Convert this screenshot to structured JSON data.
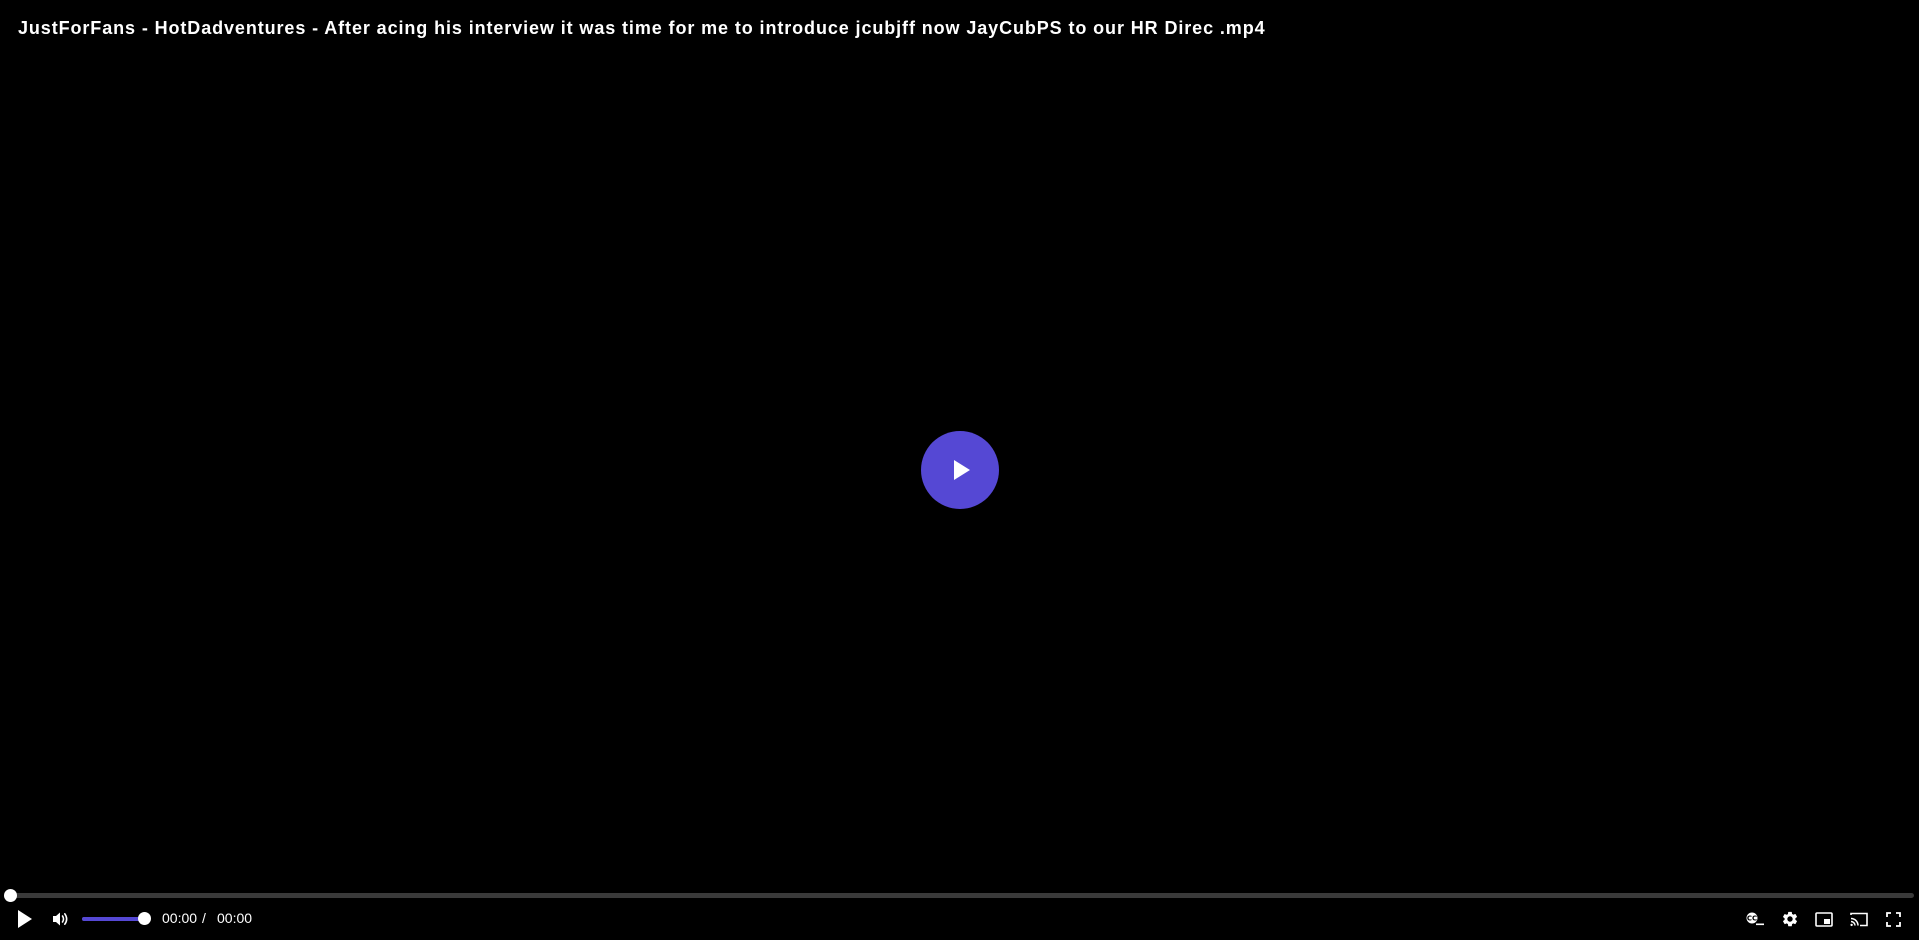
{
  "video": {
    "title": "JustForFans - HotDadventures - After acing his interview it was time for me to introduce jcubjff now JayCubPS to our HR Direc .mp4"
  },
  "playback": {
    "current_time": "00:00",
    "separator": "/",
    "duration": "00:00",
    "progress_fraction": 0,
    "volume_fraction": 1
  },
  "icons": {
    "big_play": "play-icon",
    "play": "play-icon",
    "volume": "volume-icon",
    "captions": "captions-icon",
    "settings": "gear-icon",
    "pip": "picture-in-picture-icon",
    "cast": "cast-icon",
    "fullscreen": "fullscreen-icon"
  },
  "colors": {
    "accent": "#5548d4",
    "background": "#000000",
    "text": "#ffffff",
    "track": "#3a3a3a"
  }
}
